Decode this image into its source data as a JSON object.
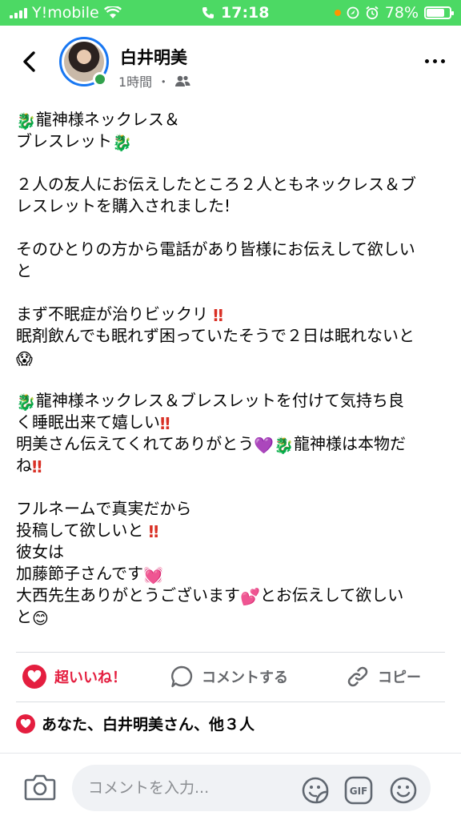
{
  "status": {
    "carrier": "Y!mobile",
    "time": "17:18",
    "battery": "78%",
    "battery_level": 0.78
  },
  "post": {
    "author": "白井明美",
    "time_ago": "1時間",
    "dot": "・",
    "lines": {
      "l1": "龍神様ネックレス＆",
      "l2": "ブレスレット",
      "l3": "２人の友人にお伝えしたところ２人ともネックレス＆ブ",
      "l4": "レスレットを購入されました!",
      "l5": "そのひとりの方から電話があり皆様にお伝えして欲しい",
      "l6": "と",
      "l7": "まず不眠症が治りビックリ",
      "l8": "眠剤飲んでも眠れず困っていたそうで２日は眠れないと",
      "l9": "龍神様ネックレス＆ブレスレットを付けて気持ち良",
      "l10": "く睡眠出来て嬉しい",
      "l11a": "明美さん伝えてくれてありがとう",
      "l11b": "龍神様は本物だ",
      "l12": "ね",
      "l13": "フルネームで真実だから",
      "l14": "投稿して欲しいと",
      "l15": "彼女は",
      "l16": "加藤節子さんです",
      "l17a": "大西先生ありがとうございます",
      "l17b": "とお伝えして欲しい",
      "l18": "と"
    },
    "emojis": {
      "dragon": "🐉",
      "bang": "‼",
      "scream": "😱",
      "purple_heart": "💜",
      "heartbeat": "💓",
      "two_hearts": "💕",
      "smile": "😊"
    }
  },
  "actions": {
    "love": "超いいね！",
    "comment": "コメントする",
    "copy": "コピー"
  },
  "reactions": {
    "summary": "あなた、白井明美さん、他３人"
  },
  "comment_bar": {
    "placeholder": "コメントを入力...",
    "gif": "GIF"
  },
  "colors": {
    "status_green": "#4cd964",
    "love_red": "#e41e3f",
    "accent_blue": "#1877f2",
    "online_green": "#31a24c"
  }
}
